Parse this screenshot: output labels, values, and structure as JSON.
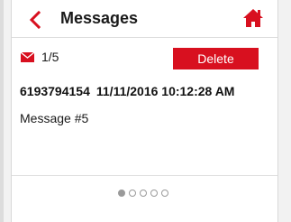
{
  "colors": {
    "accent": "#d8101f",
    "text": "#1a1a1a"
  },
  "header": {
    "title": "Messages",
    "back_icon": "chevron-left-icon",
    "home_icon": "home-icon"
  },
  "message": {
    "icon": "envelope-icon",
    "counter": "1/5",
    "delete_label": "Delete",
    "sender": "6193794154",
    "timestamp": "11/11/2016 10:12:28 AM",
    "body": "Message #5"
  },
  "pagination": {
    "total": 5,
    "current": 1
  }
}
